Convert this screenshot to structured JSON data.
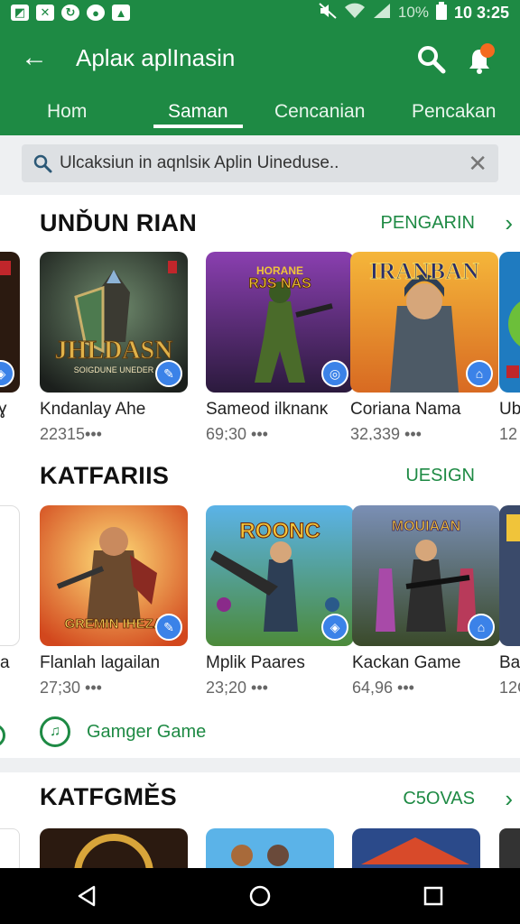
{
  "status_bar": {
    "battery_percent": "10%",
    "time": "10 3:25",
    "icons": [
      "image-icon",
      "tools-icon",
      "sync-icon",
      "chat-icon",
      "upload-icon",
      "mute-icon",
      "wifi-icon",
      "signal-icon",
      "battery-icon"
    ]
  },
  "app_bar": {
    "title": "Aplaĸ aplInasin",
    "tabs": [
      "Hom",
      "Saman",
      "Cencanian",
      "Pencakan"
    ],
    "active_tab": 1
  },
  "search": {
    "placeholder": "Ulcaksiun in aqnlsiĸ Aplin Uineduse.."
  },
  "sections": [
    {
      "title": "UNĎUN RIAN",
      "more_label": "PENGARIN",
      "peek_left_name": "ɣ",
      "peek_right_name": "Ub",
      "peek_right_meta": "12",
      "items": [
        {
          "name": "Kndanlay Ahe",
          "meta": "22315•••",
          "art_title": "JHLDASN",
          "art_sub": "SOIGDUNE UNEDER"
        },
        {
          "name": "Sameod ilknanĸ",
          "meta": "69;30 •••",
          "art_title": "RJS NAS",
          "art_sub": "HORANE"
        },
        {
          "name": "Coriana Nama",
          "meta": "32,339 •••",
          "art_title": "IRANBAN",
          "art_sub": ""
        }
      ]
    },
    {
      "title": "KATFARIIS",
      "more_label": "UESIGN",
      "peek_left_name": "a",
      "peek_right_name": "Ba",
      "peek_right_meta": "12C",
      "items": [
        {
          "name": "Flanlah lagailan",
          "meta": "27;30 •••",
          "art_title": "GREMIN IHEZA",
          "art_sub": ""
        },
        {
          "name": "Mplik Paares",
          "meta": "23;20 •••",
          "art_title": "ROONC",
          "art_sub": ""
        },
        {
          "name": "Kackan Game",
          "meta": "64,96 •••",
          "art_title": "MOUIAAN",
          "art_sub": ""
        }
      ],
      "link_label": "Gamger Game"
    },
    {
      "title": "KATFGMĚS",
      "more_label": "C5OVAS"
    }
  ],
  "colors": {
    "brand_green": "#1e8a44",
    "badge_blue": "#3b82e8",
    "notification_dot": "#f46a1f"
  }
}
